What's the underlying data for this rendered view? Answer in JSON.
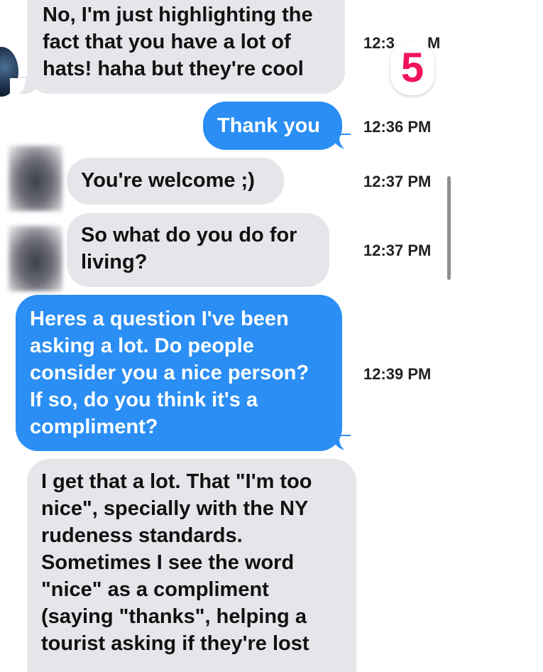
{
  "messages": [
    {
      "dir": "in",
      "text": "No, I'm just highlighting the\nfact that you have a lot of\nhats! haha but they're cool",
      "time": "12:3"
    },
    {
      "dir": "out",
      "text": "Thank you",
      "time": "12:36 PM"
    },
    {
      "dir": "in",
      "text": "You're welcome ;)",
      "time": "12:37 PM"
    },
    {
      "dir": "in",
      "text": "So what do you do for\nliving?",
      "time": "12:37 PM"
    },
    {
      "dir": "out",
      "text": "Heres a question I've been\nasking a lot. Do people\nconsider you a nice person?\nIf so, do you think it's a\ncompliment?",
      "time": "12:39 PM"
    },
    {
      "dir": "in",
      "text": "I get that a lot. That \"I'm too\nnice\", specially with the NY\nrudeness standards.\nSometimes I see the word\n\"nice\" as a compliment\n(saying \"thanks\", helping a\ntourist asking if they're lost",
      "time": ""
    }
  ],
  "time_partial_suffix": "M",
  "badge": {
    "value": "5",
    "color": "#f0145a"
  },
  "colors": {
    "incoming": "#e5e5ea",
    "outgoing": "#2a8ef5"
  }
}
